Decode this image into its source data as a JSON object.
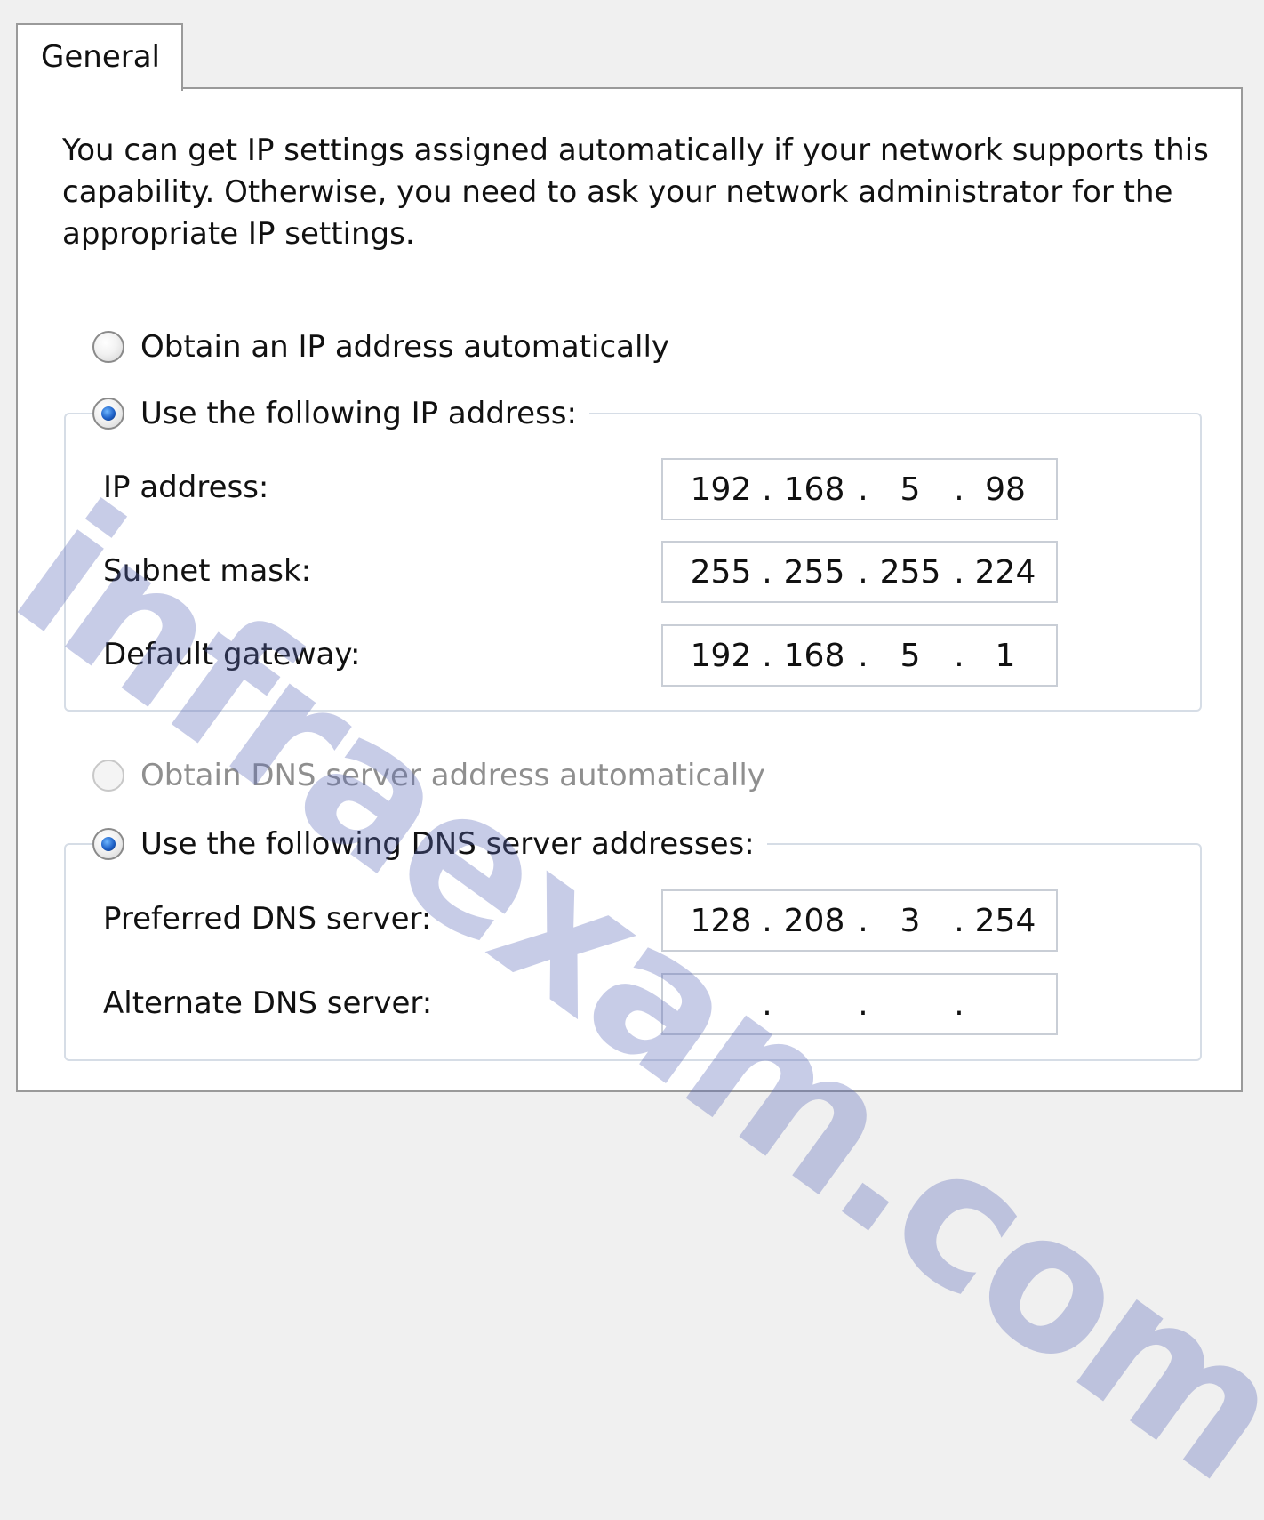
{
  "tab": {
    "label": "General"
  },
  "intro": "You can get IP settings assigned automatically if your network supports this capability. Otherwise, you need to ask your network administrator for the appropriate IP settings.",
  "ip": {
    "auto_label": "Obtain an IP address automatically",
    "manual_label": "Use the following IP address:",
    "fields": [
      {
        "label": "IP address:",
        "octets": [
          "192",
          "168",
          "5",
          "98"
        ]
      },
      {
        "label": "Subnet mask:",
        "octets": [
          "255",
          "255",
          "255",
          "224"
        ]
      },
      {
        "label": "Default gateway:",
        "octets": [
          "192",
          "168",
          "5",
          "1"
        ]
      }
    ]
  },
  "dns": {
    "auto_label": "Obtain DNS server address automatically",
    "manual_label": "Use the following DNS server addresses:",
    "fields": [
      {
        "label": "Preferred DNS server:",
        "octets": [
          "128",
          "208",
          "3",
          "254"
        ]
      },
      {
        "label": "Alternate DNS server:",
        "octets": [
          "",
          "",
          "",
          ""
        ]
      }
    ]
  },
  "watermark": "infraexam.com"
}
